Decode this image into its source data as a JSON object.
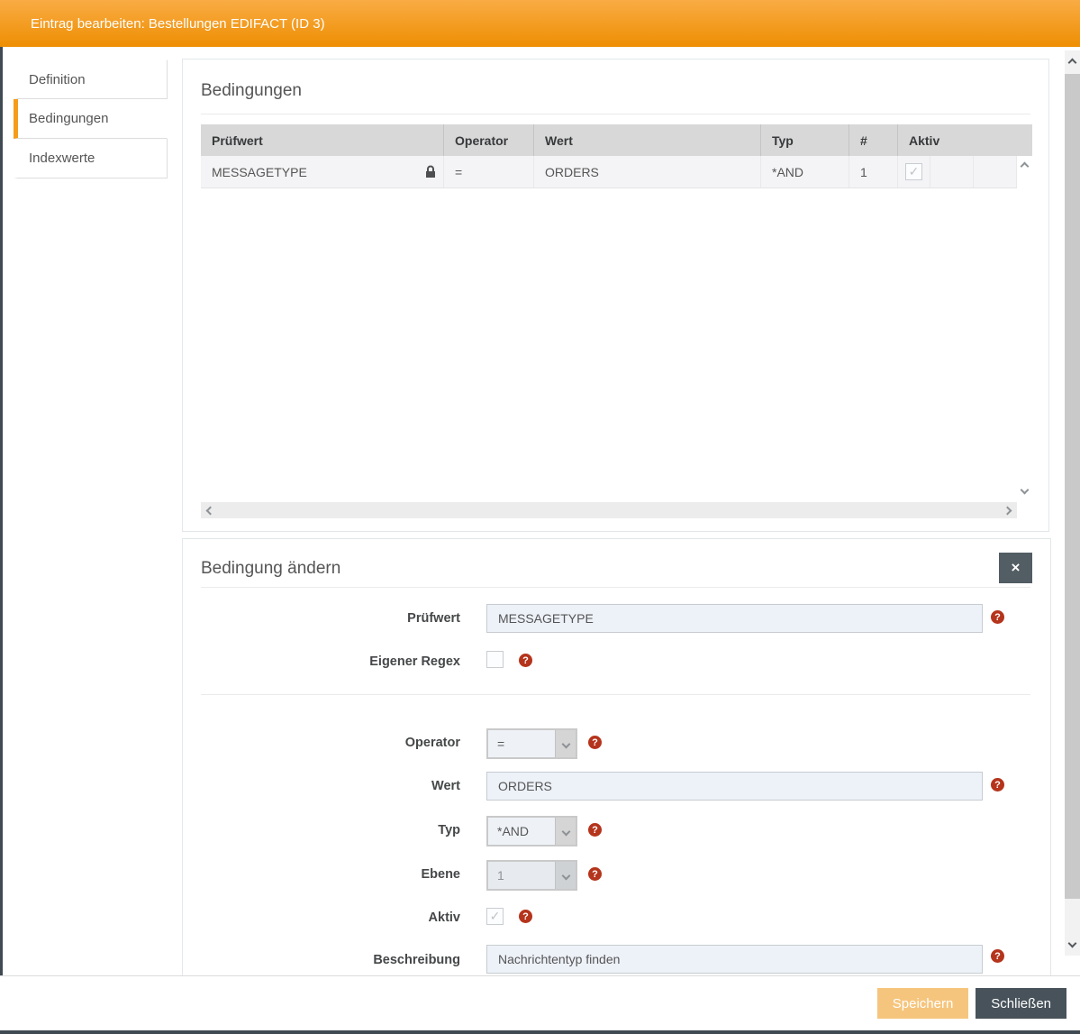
{
  "dialog": {
    "title": "Eintrag bearbeiten: Bestellungen EDIFACT (ID 3)"
  },
  "sidebar": {
    "tabs": [
      {
        "label": "Definition",
        "active": false
      },
      {
        "label": "Bedingungen",
        "active": true
      },
      {
        "label": "Indexwerte",
        "active": false
      }
    ]
  },
  "conditions": {
    "title": "Bedingungen",
    "columns": {
      "pruefwert": "Prüfwert",
      "operator": "Operator",
      "wert": "Wert",
      "typ": "Typ",
      "nr": "#",
      "aktiv": "Aktiv"
    },
    "row": {
      "pruefwert": "MESSAGETYPE",
      "locked": true,
      "operator": "=",
      "wert": "ORDERS",
      "typ": "*AND",
      "nr": "1",
      "aktiv_checked": true
    }
  },
  "edit": {
    "title": "Bedingung ändern",
    "fields": {
      "pruefwert": {
        "label": "Prüfwert",
        "value": "MESSAGETYPE"
      },
      "regex": {
        "label": "Eigener Regex",
        "checked": false
      },
      "operator": {
        "label": "Operator",
        "value": "="
      },
      "wert": {
        "label": "Wert",
        "value": "ORDERS"
      },
      "typ": {
        "label": "Typ",
        "value": "*AND"
      },
      "ebene": {
        "label": "Ebene",
        "value": "1",
        "disabled": true
      },
      "aktiv": {
        "label": "Aktiv",
        "checked": true,
        "disabled": true
      },
      "beschreibung": {
        "label": "Beschreibung",
        "value": "Nachrichtentyp finden"
      }
    }
  },
  "footer": {
    "save": "Speichern",
    "close": "Schließen"
  },
  "icons": {
    "close": "×",
    "check": "✓",
    "help": "?"
  },
  "colors": {
    "accent": "#f59c1a",
    "header_gradient_top": "#f9ac44",
    "header_gradient_bottom": "#ee8e03",
    "help_red": "#b5341c",
    "dark_slate": "#47525a",
    "save_orange": "#f6c57d"
  }
}
